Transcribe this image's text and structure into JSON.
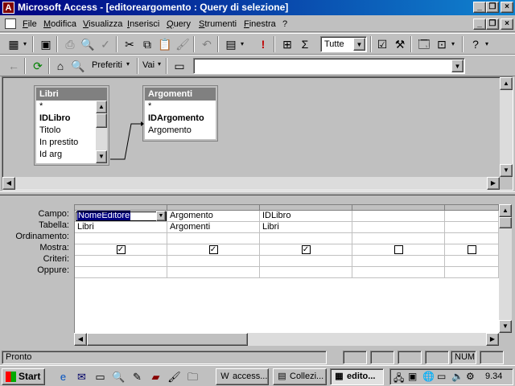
{
  "title": "Microsoft Access - [editoreargomento : Query di selezione]",
  "menu": [
    "File",
    "Modifica",
    "Visualizza",
    "Inserisci",
    "Query",
    "Strumenti",
    "Finestra",
    "?"
  ],
  "toolbar": {
    "top_values": "Tutte",
    "favorites": "Preferiti",
    "goto": "Vai"
  },
  "tables": [
    {
      "name": "Libri",
      "fields": [
        "*",
        "IDLibro",
        "Titolo",
        "In prestito",
        "Id arg"
      ],
      "bold": "IDLibro"
    },
    {
      "name": "Argomenti",
      "fields": [
        "*",
        "IDArgomento",
        "Argomento"
      ],
      "bold": "IDArgomento"
    }
  ],
  "grid": {
    "labels": [
      "Campo:",
      "Tabella:",
      "Ordinamento:",
      "Mostra:",
      "Criteri:",
      "Oppure:"
    ],
    "columns": [
      {
        "campo": "NomeEditore",
        "tabella": "Libri",
        "mostra": true
      },
      {
        "campo": "Argomento",
        "tabella": "Argomenti",
        "mostra": true
      },
      {
        "campo": "IDLibro",
        "tabella": "Libri",
        "mostra": true
      },
      {
        "campo": "",
        "tabella": "",
        "mostra": false
      },
      {
        "campo": "",
        "tabella": "",
        "mostra": false
      }
    ]
  },
  "status": {
    "text": "Pronto",
    "num": "NUM"
  },
  "taskbar": {
    "start": "Start",
    "tasks": [
      "access...",
      "Collezi...",
      "edito..."
    ],
    "clock": "9.34"
  }
}
